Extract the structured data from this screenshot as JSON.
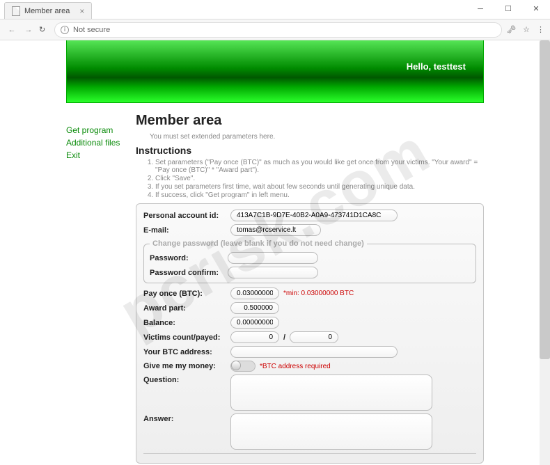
{
  "watermark": "pcrisk.com",
  "browser": {
    "tab_title": "Member area",
    "not_secure": "Not secure"
  },
  "header": {
    "hello": "Hello, testtest"
  },
  "sidebar": {
    "items": [
      {
        "label": "Get program"
      },
      {
        "label": "Additional files"
      },
      {
        "label": "Exit"
      }
    ]
  },
  "page": {
    "title": "Member area",
    "tagline": "You must set extended parameters here.",
    "instructions_heading": "Instructions",
    "instructions": [
      "Set parameters (\"Pay once (BTC)\" as much as you would like get once from your victims. \"Your award\" = \"Pay once (BTC)\" * \"Award part\").",
      "Click \"Save\".",
      "If you set parameters first time, wait about few seconds until generating unique data.",
      "If success, click \"Get program\" in left menu."
    ]
  },
  "form": {
    "account_id_label": "Personal account id:",
    "account_id": "413A7C1B-9D7E-40B2-A0A9-473741D1CA8C",
    "email_label": "E-mail:",
    "email": "tomas@rcservice.lt",
    "changepw_legend": "Change password (leave blank if you do not need change)",
    "password_label": "Password:",
    "password_confirm_label": "Password confirm:",
    "pay_once_label": "Pay once (BTC):",
    "pay_once": "0.03000000",
    "pay_once_hint": "*min: 0.03000000 BTC",
    "award_label": "Award part:",
    "award": "0.500000",
    "balance_label": "Balance:",
    "balance": "0.00000000",
    "victims_label": "Victims count/payed:",
    "victims_count": "0",
    "victims_payed": "0",
    "btc_addr_label": "Your BTC address:",
    "btc_addr": "",
    "money_label": "Give me my money:",
    "money_hint": "*BTC address required",
    "question_label": "Question:",
    "answer_label": "Answer:"
  }
}
